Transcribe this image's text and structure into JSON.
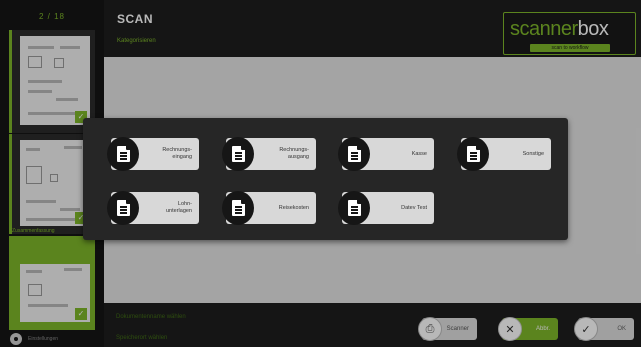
{
  "sidebar": {
    "counter": "2 / 18",
    "thumb_label": "Zusammenfassung",
    "settings_label": "Einstellungen",
    "check_glyph": "✓"
  },
  "header": {
    "title": "SCAN",
    "subtitle": "Kategorisieren"
  },
  "logo": {
    "word_a": "scanner",
    "word_b": "box",
    "tagline": "scan to workflow"
  },
  "footer": {
    "line1": "Dokumentenname wählen",
    "line2": "Speicherort wählen",
    "scanner_label": "Scanner",
    "cancel_label": "Abbr.",
    "ok_label": "OK"
  },
  "modal": {
    "categories": [
      {
        "label": "Rechnungs-\neingang",
        "icon": "document-icon"
      },
      {
        "label": "Rechnungs-\nausgang",
        "icon": "document-icon"
      },
      {
        "label": "Kasse",
        "icon": "document-icon"
      },
      {
        "label": "Sonstige",
        "icon": "document-icon"
      },
      {
        "label": "Lohn-\nunterlagen",
        "icon": "document-icon"
      },
      {
        "label": "Reisekosten",
        "icon": "document-icon"
      },
      {
        "label": "Datev Test",
        "icon": "document-icon"
      }
    ]
  },
  "colors": {
    "accent": "#7fb72a",
    "background": "#1e1e1e",
    "canvas": "#e4e4e4",
    "modal": "#262626",
    "button": "#d8d8d8"
  }
}
